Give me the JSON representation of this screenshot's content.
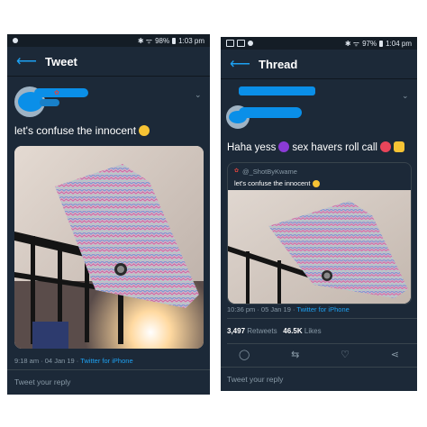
{
  "left_phone": {
    "status": {
      "battery": "98%",
      "time": "1:03 pm"
    },
    "header_title": "Tweet",
    "tweet_text": "let's confuse the innocent",
    "timestamp": "9:18 am · 04 Jan 19 · ",
    "source": "Twitter for iPhone",
    "reply_placeholder": "Tweet your reply"
  },
  "right_phone": {
    "status": {
      "battery": "97%",
      "time": "1:04 pm"
    },
    "header_title": "Thread",
    "tweet_text": "Haha yess",
    "tweet_text_2": "sex havers roll call",
    "quote": {
      "handle": "@_ShotByKwame",
      "text": "let's confuse the innocent"
    },
    "timestamp": "10:36 pm · 05 Jan 19 · ",
    "source": "Twitter for iPhone",
    "retweets_count": "3,497",
    "retweets_label": "Retweets",
    "likes_count": "46.5K",
    "likes_label": "Likes",
    "reply_placeholder": "Tweet your reply"
  },
  "colors": {
    "background": "#1c2938",
    "accent": "#1da1f2",
    "muted": "#8899a6"
  }
}
